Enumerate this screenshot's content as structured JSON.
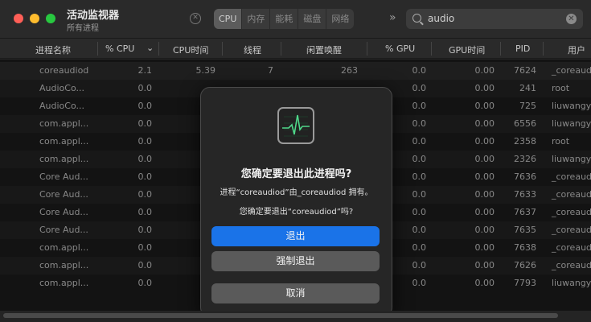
{
  "window": {
    "title": "活动监视器",
    "subtitle": "所有进程"
  },
  "toolbar": {
    "tabs": [
      "CPU",
      "内存",
      "能耗",
      "磁盘",
      "网络"
    ],
    "active_tab": "CPU",
    "more": "»",
    "search_value": "audio"
  },
  "table": {
    "columns": [
      "进程名称",
      "% CPU",
      "CPU时间",
      "线程",
      "闲置唤醒",
      "% GPU",
      "GPU时间",
      "PID",
      "用户"
    ],
    "sort_indicator": "⌄",
    "rows": [
      [
        "coreaudiod",
        "2.1",
        "5.39",
        "7",
        "263",
        "0.0",
        "0.00",
        "7624",
        "_coreaudiod"
      ],
      [
        "AudioCo...",
        "0.0",
        "",
        "",
        "",
        "0.0",
        "0.00",
        "241",
        "root"
      ],
      [
        "AudioCo...",
        "0.0",
        "",
        "",
        "",
        "0.0",
        "0.00",
        "725",
        "liuwangyang"
      ],
      [
        "com.appl...",
        "0.0",
        "",
        "",
        "",
        "0.0",
        "0.00",
        "6556",
        "liuwangyang"
      ],
      [
        "com.appl...",
        "0.0",
        "",
        "",
        "",
        "0.0",
        "0.00",
        "2358",
        "root"
      ],
      [
        "com.appl...",
        "0.0",
        "",
        "",
        "",
        "0.0",
        "0.00",
        "2326",
        "liuwangyang"
      ],
      [
        "Core Aud...",
        "0.0",
        "",
        "",
        "",
        "0.0",
        "0.00",
        "7636",
        "_coreaudiod"
      ],
      [
        "Core Aud...",
        "0.0",
        "",
        "",
        "",
        "0.0",
        "0.00",
        "7633",
        "_coreaudiod"
      ],
      [
        "Core Aud...",
        "0.0",
        "",
        "",
        "",
        "0.0",
        "0.00",
        "7637",
        "_coreaudiod"
      ],
      [
        "Core Aud...",
        "0.0",
        "",
        "",
        "",
        "0.0",
        "0.00",
        "7635",
        "_coreaudiod"
      ],
      [
        "com.appl...",
        "0.0",
        "",
        "",
        "",
        "0.0",
        "0.00",
        "7638",
        "_coreaudiod"
      ],
      [
        "com.appl...",
        "0.0",
        "",
        "",
        "",
        "0.0",
        "0.00",
        "7626",
        "_coreaudiod"
      ],
      [
        "com.appl...",
        "0.0",
        "",
        "",
        "",
        "0.0",
        "0.00",
        "7793",
        "liuwangyang"
      ]
    ]
  },
  "dialog": {
    "title": "您确定要退出此进程吗?",
    "message1": "进程“coreaudiod”由_coreaudiod 拥有。",
    "message2": "您确定要退出“coreaudiod”吗?",
    "quit_label": "退出",
    "force_quit_label": "强制退出",
    "cancel_label": "取消"
  },
  "icons": {
    "close": "close-icon",
    "search": "search-icon",
    "clear": "clear-icon",
    "stop": "stop-process-icon",
    "app": "activity-monitor-icon"
  },
  "colors": {
    "accent": "#1a73e8",
    "close": "#ff5f57",
    "minimize": "#febc2e",
    "maximize": "#28c840"
  }
}
